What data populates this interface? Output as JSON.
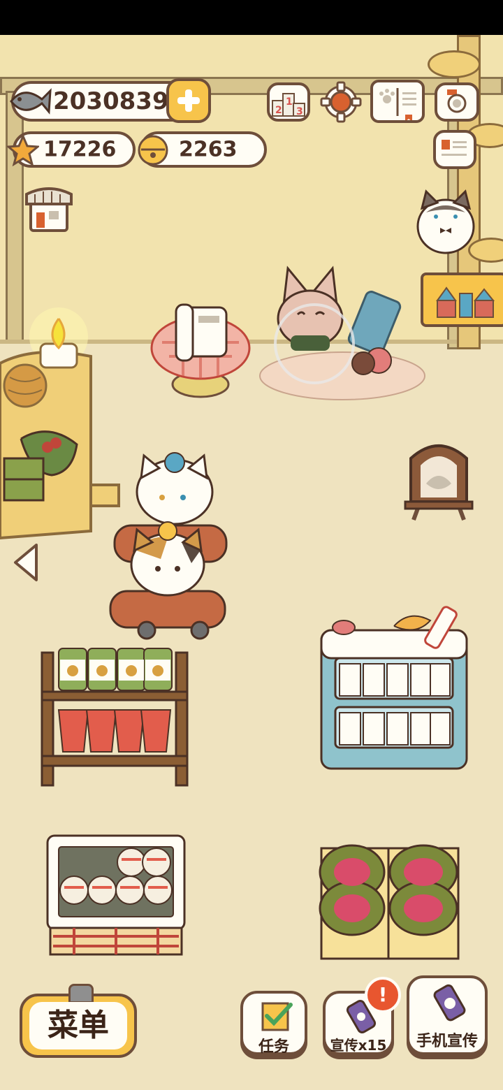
{
  "currency": {
    "fish": "2030839",
    "stars": "17226",
    "bells": "2263"
  },
  "icons": {
    "fish": "fish-icon",
    "add": "plus-icon",
    "star": "star-icon",
    "bell": "bell-icon",
    "ranking": "podium-icon",
    "settings": "gear-icon",
    "book": "book-icon",
    "camera": "camera-icon",
    "profile": "id-card-icon",
    "shop": "shop-icon",
    "toys": "toy-blocks-icon",
    "back": "left-arrow-icon",
    "tasks": "checklist-icon",
    "promo": "phone-icon",
    "alert": "exclamation-icon"
  },
  "ranking_digits": [
    "2",
    "1",
    "3"
  ],
  "bottom_bar": {
    "menu_label": "菜单",
    "tasks_label": "任务",
    "promo_label": "宣传x15",
    "phone_promo_label": "手机宣传",
    "alert_badge": "!"
  },
  "colors": {
    "wall": "#f2e3ae",
    "floor": "#efe3bf",
    "outline": "#6e4e3a",
    "accent_yellow": "#f7c44b",
    "alert_red": "#e8562f"
  }
}
